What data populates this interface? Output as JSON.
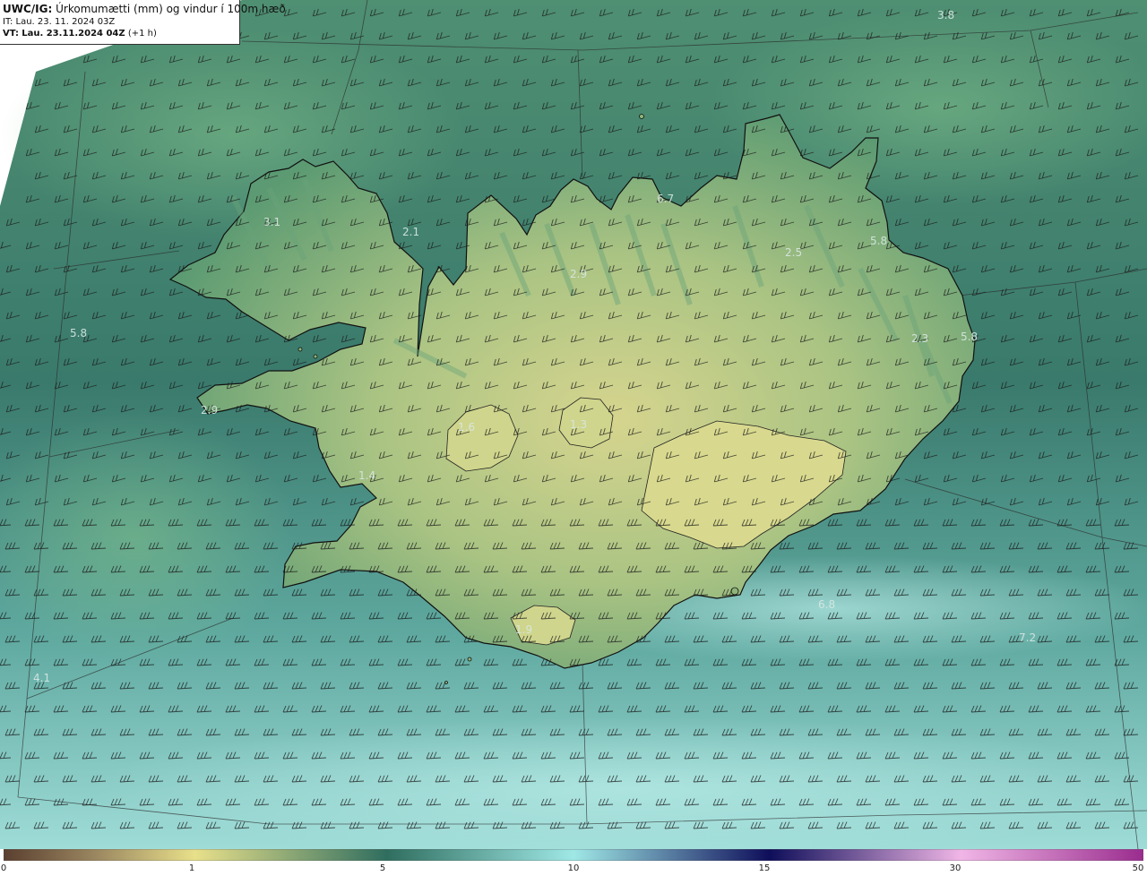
{
  "header": {
    "model": "UWC/IG:",
    "title": "Úrkomumætti (mm) og vindur í 100m hæð",
    "it_line": "IT: Lau. 23. 11. 2024 03Z",
    "vt_prefix": "VT:",
    "vt_value": "Lau. 23.11.2024 04Z",
    "vt_suffix": "(+1 h)"
  },
  "value_labels": [
    "3.8",
    "3.1",
    "2.1",
    "6.7",
    "5.8",
    "2.5",
    "2.9",
    "5.8",
    "2.3",
    "5.8",
    "2.9",
    "1.6",
    "1.3",
    "1.4",
    "6.8",
    "7.2",
    "4.1",
    "1.9"
  ],
  "colorbar": {
    "ticks": [
      "0",
      "1",
      "5",
      "10",
      "15",
      "30",
      "50"
    ],
    "colors": [
      "#5a3f2f",
      "#9a8660",
      "#e8e08a",
      "#2f6e5f",
      "#9fe8e6",
      "#0e0e5a",
      "#f0b6e6",
      "#9a2c8e"
    ]
  },
  "map_colors": {
    "sea": "#3b7e6e",
    "land_low": "#c9cf86",
    "land_high": "#5d9a6a",
    "coast": "#111111",
    "barb": "#1a1a1a"
  }
}
